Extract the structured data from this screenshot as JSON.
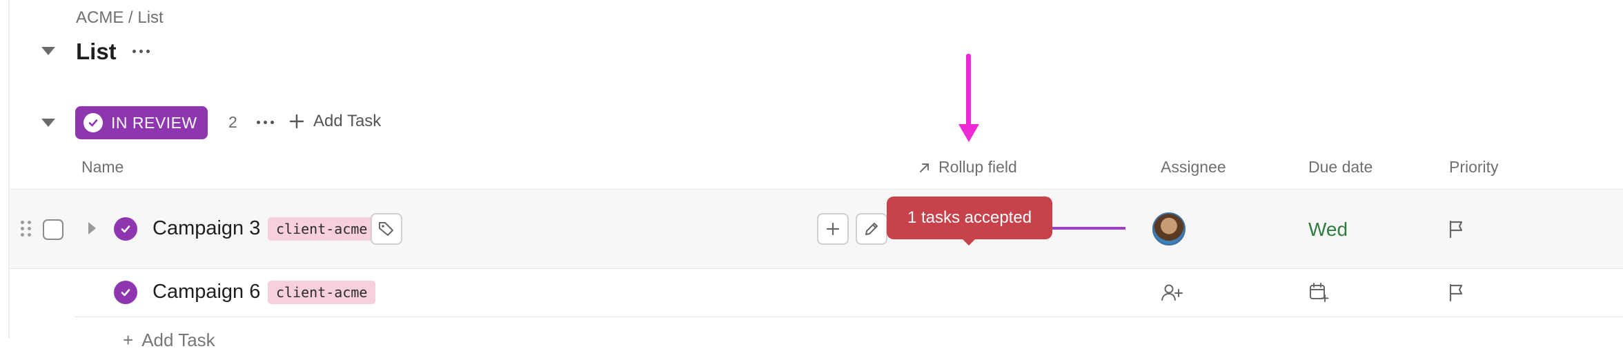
{
  "breadcrumb": "ACME / List",
  "page_title": "List",
  "group": {
    "status_label": "IN REVIEW",
    "count": "2",
    "add_task_label": "Add Task",
    "status_color": "#8e36b0"
  },
  "columns": {
    "name": "Name",
    "rollup": "Rollup field",
    "rollup_icon": "arrow-up-right-icon",
    "assignee": "Assignee",
    "due_date": "Due date",
    "priority": "Priority"
  },
  "tasks": [
    {
      "name": "Campaign 3",
      "tag": "client-acme",
      "due": "Wed",
      "assignee": "avatar"
    },
    {
      "name": "Campaign 6",
      "tag": "client-acme",
      "due": "",
      "assignee": "add-assignee-icon"
    }
  ],
  "tooltip": {
    "text": "1 tasks accepted",
    "color": "#c8424b"
  },
  "bottom_add_task": "Add Task",
  "colors": {
    "tag_bg": "#f8cfdc",
    "due_text": "#2f7a3e",
    "annotation_arrow": "#ee2ad6",
    "connector": "#9b3fd0"
  }
}
